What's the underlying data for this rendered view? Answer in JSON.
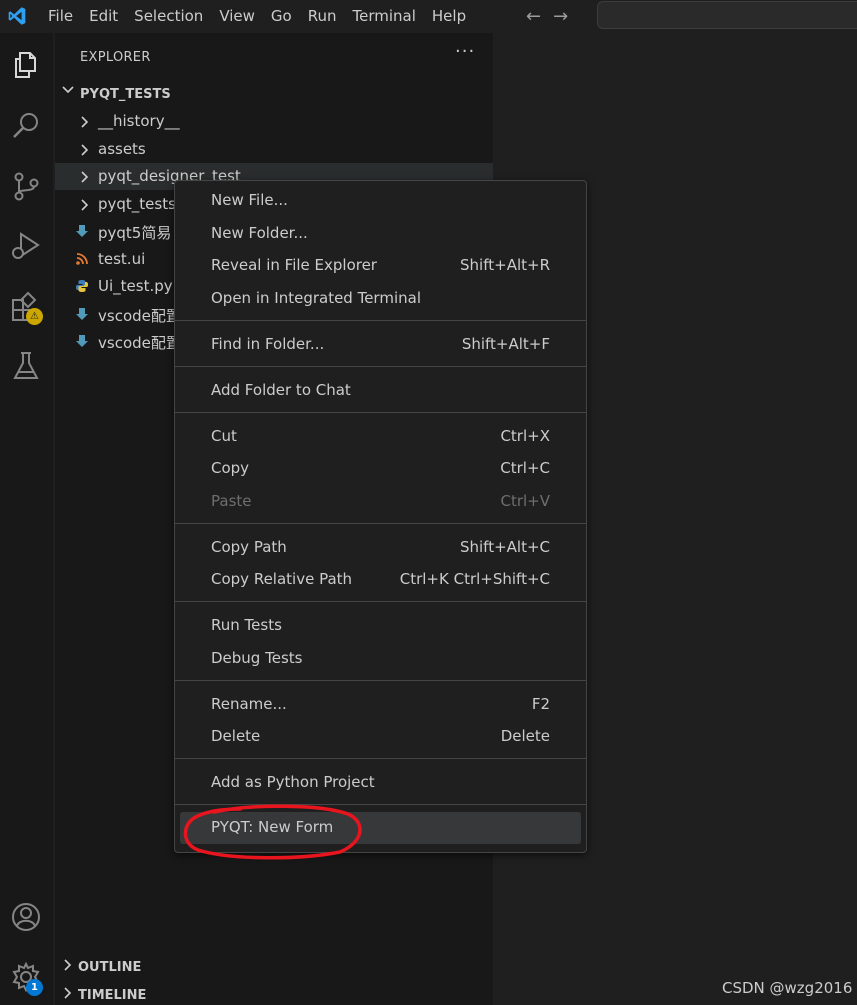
{
  "menubar": {
    "items": [
      "File",
      "Edit",
      "Selection",
      "View",
      "Go",
      "Run",
      "Terminal",
      "Help"
    ]
  },
  "nav": {
    "back": "←",
    "forward": "→"
  },
  "activity_bar": {
    "items": [
      "explorer-icon",
      "search-icon",
      "source-control-icon",
      "run-debug-icon",
      "extensions-icon",
      "testing-icon"
    ],
    "extensions_badge": "⚠",
    "accounts": "accounts-icon",
    "manage": "gear-icon",
    "manage_badge": "1"
  },
  "sidebar": {
    "title": "EXPLORER",
    "more": "···",
    "folder": "PYQT_TESTS",
    "tree": [
      {
        "label": "__history__",
        "type": "folder"
      },
      {
        "label": "assets",
        "type": "folder"
      },
      {
        "label": "pyqt_designer_test",
        "type": "folder",
        "active": true
      },
      {
        "label": "pyqt_tests",
        "type": "folder"
      },
      {
        "label": "pyqt5简易",
        "type": "markdown"
      },
      {
        "label": "test.ui",
        "type": "rss"
      },
      {
        "label": "Ui_test.py",
        "type": "python"
      },
      {
        "label": "vscode配置",
        "type": "markdown"
      },
      {
        "label": "vscode配置",
        "type": "markdown"
      }
    ],
    "outline": "OUTLINE",
    "timeline": "TIMELINE"
  },
  "context_menu": {
    "groups": [
      [
        {
          "label": "New File...",
          "shortcut": ""
        },
        {
          "label": "New Folder...",
          "shortcut": ""
        },
        {
          "label": "Reveal in File Explorer",
          "shortcut": "Shift+Alt+R"
        },
        {
          "label": "Open in Integrated Terminal",
          "shortcut": ""
        }
      ],
      [
        {
          "label": "Find in Folder...",
          "shortcut": "Shift+Alt+F"
        }
      ],
      [
        {
          "label": "Add Folder to Chat",
          "shortcut": ""
        }
      ],
      [
        {
          "label": "Cut",
          "shortcut": "Ctrl+X"
        },
        {
          "label": "Copy",
          "shortcut": "Ctrl+C"
        },
        {
          "label": "Paste",
          "shortcut": "Ctrl+V",
          "disabled": true
        }
      ],
      [
        {
          "label": "Copy Path",
          "shortcut": "Shift+Alt+C"
        },
        {
          "label": "Copy Relative Path",
          "shortcut": "Ctrl+K Ctrl+Shift+C"
        }
      ],
      [
        {
          "label": "Run Tests",
          "shortcut": ""
        },
        {
          "label": "Debug Tests",
          "shortcut": ""
        }
      ],
      [
        {
          "label": "Rename...",
          "shortcut": "F2"
        },
        {
          "label": "Delete",
          "shortcut": "Delete"
        }
      ],
      [
        {
          "label": "Add as Python Project",
          "shortcut": ""
        }
      ],
      [
        {
          "label": "PYQT: New Form",
          "shortcut": "",
          "highlighted": true
        }
      ]
    ]
  },
  "watermark": "CSDN @wzg2016",
  "colors": {
    "accent_blue": "#3794ff",
    "annotation_red": "#e8141e",
    "warning": "#cca700"
  }
}
